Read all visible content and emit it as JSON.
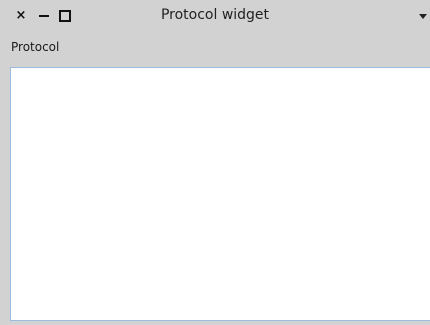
{
  "window": {
    "title": "Protocol widget",
    "buttons": {
      "close_glyph": "×",
      "close_icon": "close-icon",
      "minimize_icon": "minimize-icon",
      "maximize_icon": "maximize-icon"
    },
    "menu_icon": "chevron-down-icon"
  },
  "main": {
    "label": "Protocol",
    "list": {
      "items": []
    }
  },
  "colors": {
    "background": "#d2d2d2",
    "list_background": "#ffffff",
    "list_border": "#9bbbe0"
  }
}
